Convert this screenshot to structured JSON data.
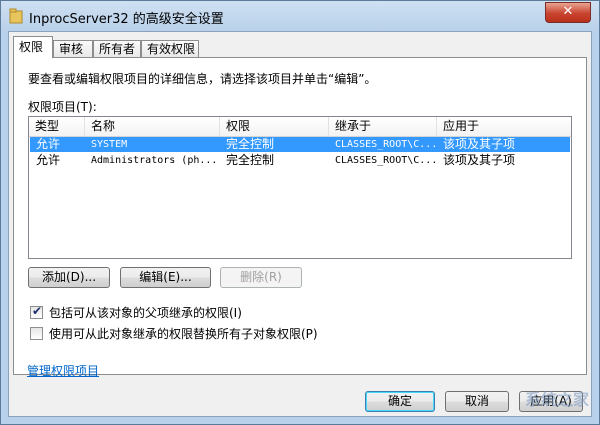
{
  "window": {
    "title": "InprocServer32 的高级安全设置",
    "close_label": "✕"
  },
  "tabs": [
    {
      "label": "权限"
    },
    {
      "label": "审核"
    },
    {
      "label": "所有者"
    },
    {
      "label": "有效权限"
    }
  ],
  "panel": {
    "description": "要查看或编辑权限项目的详细信息，请选择该项目并单击“编辑”。",
    "list_label": "权限项目(T):",
    "columns": [
      "类型",
      "名称",
      "权限",
      "继承于",
      "应用于"
    ],
    "rows": [
      {
        "type": "允许",
        "name": "SYSTEM",
        "permission": "完全控制",
        "inherited": "CLASSES_ROOT\\C...",
        "applies": "该项及其子项",
        "selected": true
      },
      {
        "type": "允许",
        "name": "Administrators (ph...",
        "permission": "完全控制",
        "inherited": "CLASSES_ROOT\\C...",
        "applies": "该项及其子项",
        "selected": false
      }
    ],
    "buttons": {
      "add": "添加(D)...",
      "edit": "编辑(E)...",
      "remove": "删除(R)"
    },
    "checkboxes": [
      {
        "label": "包括可从该对象的父项继承的权限(I)",
        "checked": true
      },
      {
        "label": "使用可从此对象继承的权限替换所有子对象权限(P)",
        "checked": false
      }
    ],
    "link": "管理权限项目"
  },
  "footer": {
    "ok": "确定",
    "cancel": "取消",
    "apply": "应用(A)"
  },
  "watermark": "系统之家",
  "colors": {
    "selection": "#3399ff",
    "link": "#0066cc"
  }
}
